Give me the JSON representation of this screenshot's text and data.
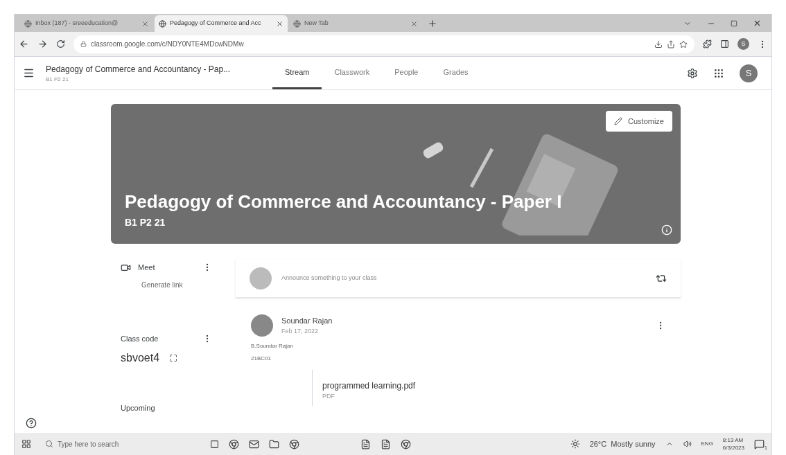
{
  "browser": {
    "tabs": [
      {
        "title": "Inbox (187) - sreeeducation@",
        "selected": false
      },
      {
        "title": "Pedagogy of Commerce and Acc",
        "selected": true
      },
      {
        "title": "New Tab",
        "selected": false
      }
    ],
    "url": "classroom.google.com/c/NDY0NTE4MDcwNDMw",
    "profile_initial": "S"
  },
  "header": {
    "course_title": "Pedagogy of Commerce and Accountancy - Pap...",
    "course_section": "B1 P2 21",
    "nav": [
      {
        "label": "Stream",
        "selected": true
      },
      {
        "label": "Classwork",
        "selected": false
      },
      {
        "label": "People",
        "selected": false
      },
      {
        "label": "Grades",
        "selected": false
      }
    ],
    "avatar_initial": "S"
  },
  "banner": {
    "title": "Pedagogy of Commerce and Accountancy - Paper I",
    "section": "B1 P2 21",
    "customize": "Customize"
  },
  "meet": {
    "label": "Meet",
    "link": "Generate link"
  },
  "class_code": {
    "label": "Class code",
    "code": "sbvoet4"
  },
  "upcoming": {
    "label": "Upcoming"
  },
  "announce": {
    "placeholder": "Announce something to your class"
  },
  "post": {
    "author": "Soundar Rajan",
    "date": "Feb 17, 2022",
    "lines": [
      "B.Soundar Rajan",
      "21BC01"
    ],
    "attachment": {
      "name": "programmed learning.pdf",
      "type": "PDF"
    }
  },
  "taskbar": {
    "search_placeholder": "Type here to search",
    "weather": "26°C  Mostly sunny",
    "language": "ENG",
    "time": "8:13 AM",
    "date": "6/3/2023",
    "notifications": "1"
  }
}
